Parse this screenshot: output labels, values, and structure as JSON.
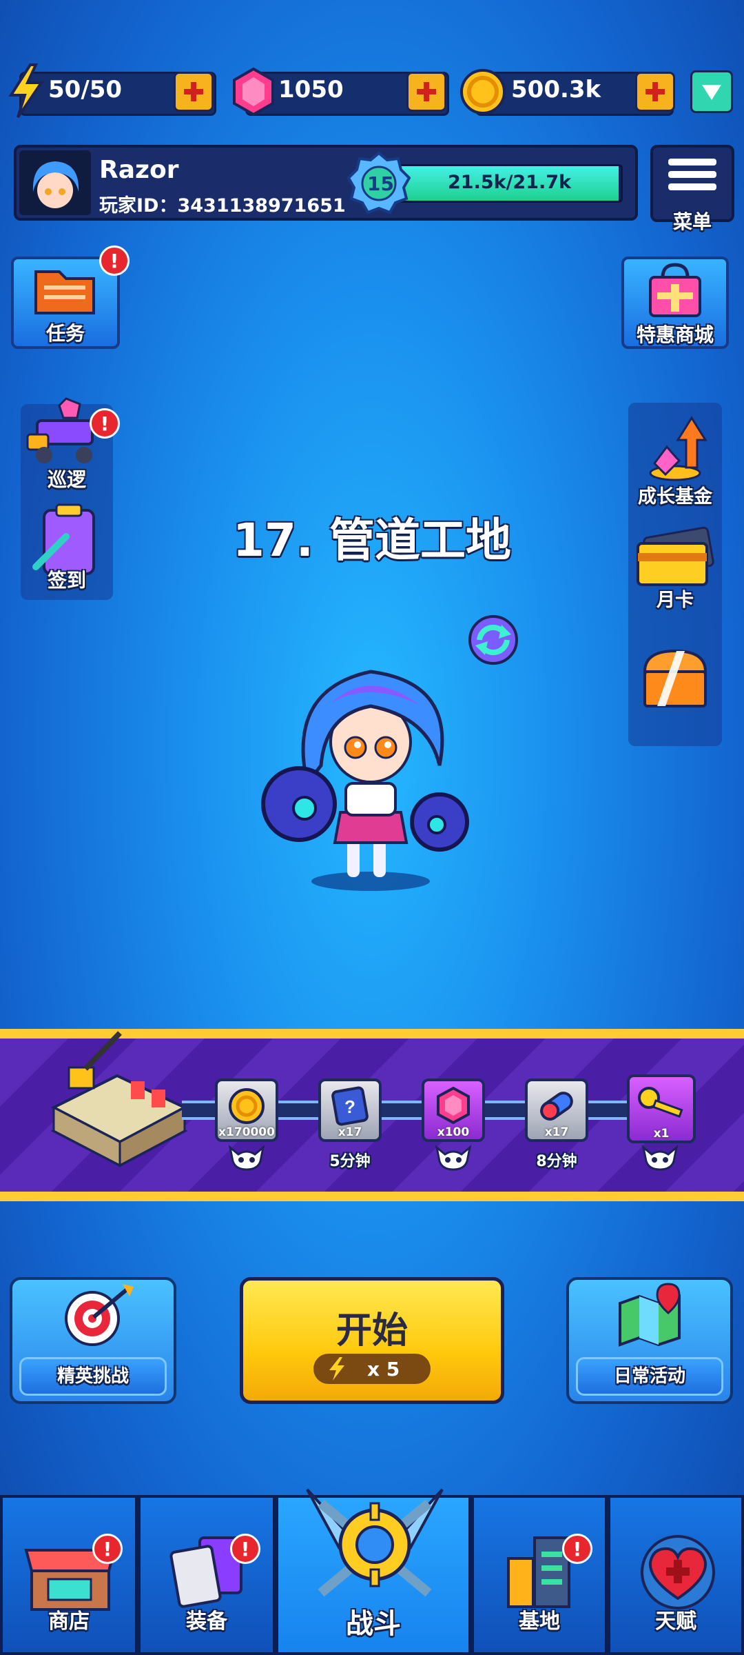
{
  "resources": {
    "energy": "50/50",
    "gems": "1050",
    "coins": "500.3k"
  },
  "profile": {
    "name": "Razor",
    "player_id": "玩家ID：3431138971651",
    "level": "15",
    "xp_text": "21.5k/21.7k",
    "xp_progress": 0.99
  },
  "menu": {
    "label": "菜单"
  },
  "left_buttons": {
    "tasks": "任务",
    "patrol": "巡逻",
    "checkin": "签到"
  },
  "right_buttons": {
    "special_shop": "特惠商城",
    "growth_fund": "成长基金",
    "monthly_card": "月卡"
  },
  "stage": {
    "title": "17. 管道工地"
  },
  "rewards": [
    {
      "icon": "coin-icon",
      "qty": "x170000",
      "label": ""
    },
    {
      "icon": "ticket-icon",
      "qty": "x17",
      "label": "5分钟"
    },
    {
      "icon": "gem-icon",
      "qty": "x100",
      "label": ""
    },
    {
      "icon": "capsule-icon",
      "qty": "x17",
      "label": "8分钟"
    },
    {
      "icon": "key-icon",
      "qty": "x1",
      "label": ""
    }
  ],
  "actions": {
    "elite": "精英挑战",
    "start": "开始",
    "start_cost": "x 5",
    "daily": "日常活动"
  },
  "nav": {
    "shop": "商店",
    "equipment": "装备",
    "battle": "战斗",
    "base": "基地",
    "talent": "天赋"
  },
  "colors": {
    "accent_yellow": "#ffc90d",
    "alert_red": "#e7262d",
    "xp_green": "#1ed08f"
  }
}
